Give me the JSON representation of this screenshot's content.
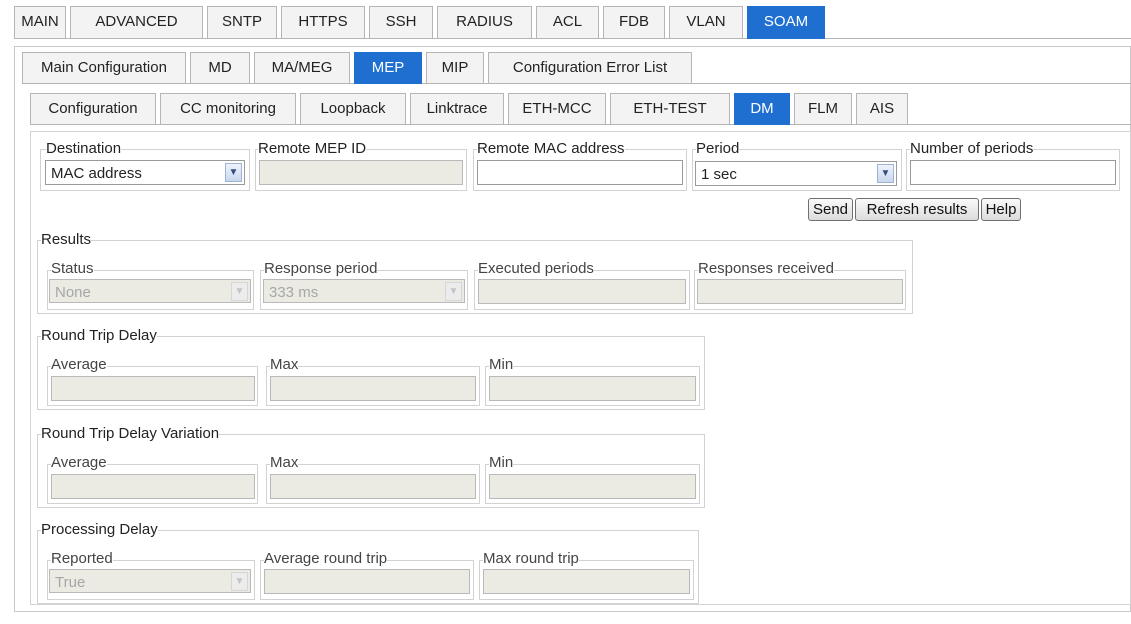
{
  "tabs_row1": [
    "MAIN",
    "ADVANCED",
    "SNTP",
    "HTTPS",
    "SSH",
    "RADIUS",
    "ACL",
    "FDB",
    "VLAN",
    "SOAM"
  ],
  "tabs_row2": [
    "Main Configuration",
    "MD",
    "MA/MEG",
    "MEP",
    "MIP",
    "Configuration Error List"
  ],
  "tabs_row3": [
    "Configuration",
    "CC monitoring",
    "Loopback",
    "Linktrace",
    "ETH-MCC",
    "ETH-TEST",
    "DM",
    "FLM",
    "AIS"
  ],
  "active": {
    "row1": "SOAM",
    "row2": "MEP",
    "row3": "DM"
  },
  "form": {
    "destination_label": "Destination",
    "destination_value": "MAC address",
    "remote_mep_label": "Remote MEP ID",
    "remote_mep_value": "",
    "remote_mac_label": "Remote MAC address",
    "remote_mac_value": "",
    "period_label": "Period",
    "period_value": "1 sec",
    "num_periods_label": "Number of periods",
    "num_periods_value": ""
  },
  "buttons": {
    "send": "Send",
    "refresh": "Refresh results",
    "help": "Help"
  },
  "results": {
    "title": "Results",
    "status_label": "Status",
    "status_value": "None",
    "response_period_label": "Response period",
    "response_period_value": "333 ms",
    "executed_label": "Executed periods",
    "received_label": "Responses received"
  },
  "rtd": {
    "title": "Round Trip Delay",
    "average_label": "Average",
    "max_label": "Max",
    "min_label": "Min"
  },
  "rtdv": {
    "title": "Round Trip Delay Variation",
    "average_label": "Average",
    "max_label": "Max",
    "min_label": "Min"
  },
  "processing": {
    "title": "Processing Delay",
    "reported_label": "Reported",
    "reported_value": "True",
    "avg_rt_label": "Average round trip",
    "max_rt_label": "Max round trip"
  },
  "icons": {
    "dropdown": "chevron-down-icon"
  },
  "colors": {
    "active_tab": "#1f6fd1",
    "disabled_field": "#ebebe4"
  }
}
